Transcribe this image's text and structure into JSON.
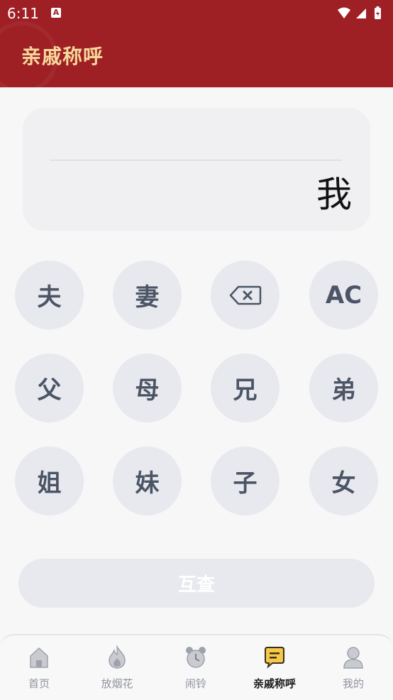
{
  "status_bar": {
    "time": "6:11",
    "notification_icon": "A"
  },
  "header": {
    "title": "亲戚称呼"
  },
  "display": {
    "input": "",
    "result": "我"
  },
  "keypad": [
    {
      "name": "key-husband",
      "label": "夫"
    },
    {
      "name": "key-wife",
      "label": "妻"
    },
    {
      "name": "backspace-button",
      "label": "",
      "icon": "backspace-icon"
    },
    {
      "name": "clear-button",
      "label": "AC"
    },
    {
      "name": "key-father",
      "label": "父"
    },
    {
      "name": "key-mother",
      "label": "母"
    },
    {
      "name": "key-elder-brother",
      "label": "兄"
    },
    {
      "name": "key-younger-brother",
      "label": "弟"
    },
    {
      "name": "key-elder-sister",
      "label": "姐"
    },
    {
      "name": "key-younger-sister",
      "label": "妹"
    },
    {
      "name": "key-son",
      "label": "子"
    },
    {
      "name": "key-daughter",
      "label": "女"
    }
  ],
  "query_button": {
    "label": "互查"
  },
  "tabs": [
    {
      "label": "首页",
      "icon": "home-icon",
      "active": false
    },
    {
      "label": "放烟花",
      "icon": "flame-icon",
      "active": false
    },
    {
      "label": "闹铃",
      "icon": "alarm-clock-icon",
      "active": false
    },
    {
      "label": "亲戚称呼",
      "icon": "chat-note-icon",
      "active": true
    },
    {
      "label": "我的",
      "icon": "user-icon",
      "active": false
    }
  ],
  "colors": {
    "header_bg": "#9e1f24",
    "title_text": "#f7d89b",
    "key_bg": "#e8e9ef",
    "key_text": "#4b5565"
  }
}
